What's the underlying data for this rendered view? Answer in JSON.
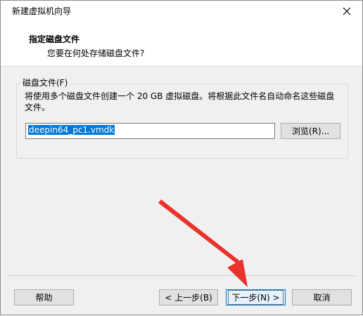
{
  "window": {
    "title": "新建虚拟机向导"
  },
  "header": {
    "title": "指定磁盘文件",
    "subtitle": "您要在何处存储磁盘文件?"
  },
  "disk_group": {
    "legend": "磁盘文件(F)",
    "description": "将使用多个磁盘文件创建一个 20 GB 虚拟磁盘。将根据此文件名自动命名这些磁盘文件。",
    "file_value": "deepin64_pc1.vmdk",
    "browse_label": "浏览(R)..."
  },
  "footer": {
    "help_label": "帮助",
    "back_label": "< 上一步(B)",
    "next_label": "下一步(N) >",
    "cancel_label": "取消"
  },
  "colors": {
    "accent": "#0078d7",
    "annotation_arrow": "#e8322b"
  }
}
